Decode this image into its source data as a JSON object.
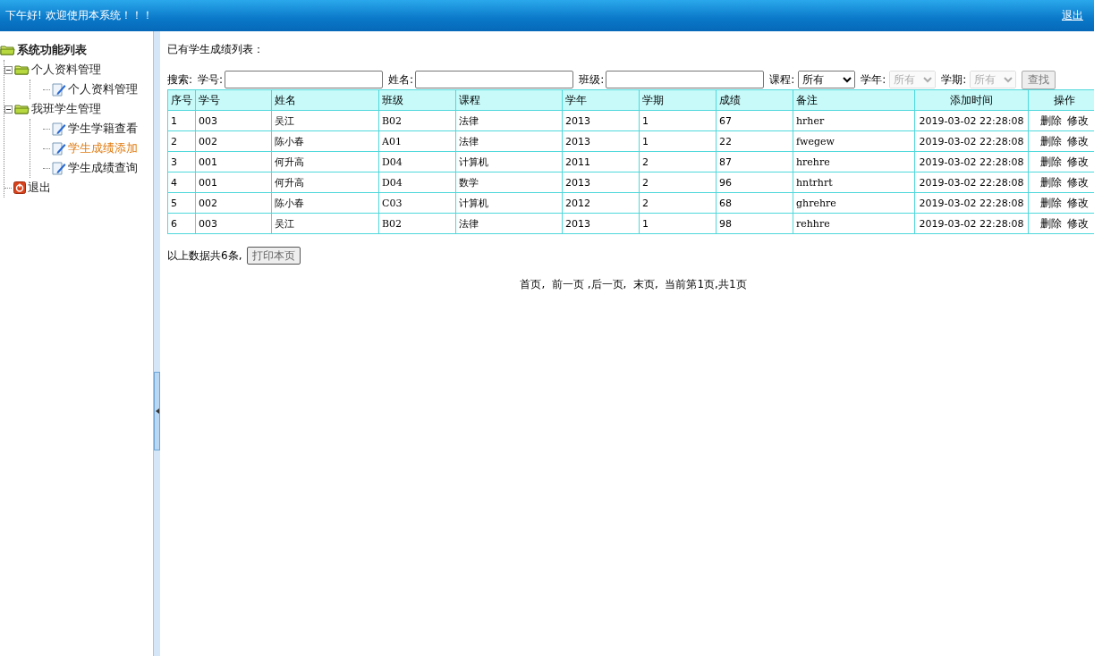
{
  "header": {
    "greeting": "下午好! 欢迎使用本系统！！！",
    "logout": "退出"
  },
  "sidebar": {
    "title": "系统功能列表",
    "items": [
      {
        "label": "个人资料管理",
        "kind": "folder",
        "expanded": true,
        "children": [
          {
            "label": "个人资料管理",
            "kind": "page",
            "selected": false
          }
        ]
      },
      {
        "label": "我班学生管理",
        "kind": "folder",
        "expanded": true,
        "children": [
          {
            "label": "学生学籍查看",
            "kind": "page",
            "selected": false
          },
          {
            "label": "学生成绩添加",
            "kind": "page",
            "selected": true
          },
          {
            "label": "学生成绩查询",
            "kind": "page",
            "selected": false
          }
        ]
      },
      {
        "label": "退出",
        "kind": "exit",
        "selected": false
      }
    ]
  },
  "page_title": "已有学生成绩列表：",
  "search": {
    "label": "搜索:",
    "fields": [
      {
        "kind": "text",
        "label": "学号:"
      },
      {
        "kind": "text",
        "label": "姓名:"
      },
      {
        "kind": "text",
        "label": "班级:"
      },
      {
        "kind": "select",
        "label": "课程:",
        "value": "所有",
        "disabled": false
      },
      {
        "kind": "select",
        "label": "学年:",
        "value": "所有",
        "disabled": true
      },
      {
        "kind": "select",
        "label": "学期:",
        "value": "所有",
        "disabled": true
      }
    ],
    "button": "查找"
  },
  "table": {
    "columns": [
      "序号",
      "学号",
      "姓名",
      "班级",
      "课程",
      "学年",
      "学期",
      "成绩",
      "备注",
      "添加时间",
      "操作"
    ],
    "rows": [
      {
        "cells": [
          "1",
          "003",
          "吴江",
          "B02",
          "法律",
          "2013",
          "1",
          "67",
          "hrher",
          "2019-03-02 22:28:08"
        ],
        "actions": [
          "删除",
          "修改"
        ]
      },
      {
        "cells": [
          "2",
          "002",
          "陈小春",
          "A01",
          "法律",
          "2013",
          "1",
          "22",
          "fwegew",
          "2019-03-02 22:28:08"
        ],
        "actions": [
          "删除",
          "修改"
        ]
      },
      {
        "cells": [
          "3",
          "001",
          "何升高",
          "D04",
          "计算机",
          "2011",
          "2",
          "87",
          "hrehre",
          "2019-03-02 22:28:08"
        ],
        "actions": [
          "删除",
          "修改"
        ]
      },
      {
        "cells": [
          "4",
          "001",
          "何升高",
          "D04",
          "数学",
          "2013",
          "2",
          "96",
          "hntrhrt",
          "2019-03-02 22:28:08"
        ],
        "actions": [
          "删除",
          "修改"
        ]
      },
      {
        "cells": [
          "5",
          "002",
          "陈小春",
          "C03",
          "计算机",
          "2012",
          "2",
          "68",
          "ghrehre",
          "2019-03-02 22:28:08"
        ],
        "actions": [
          "删除",
          "修改"
        ]
      },
      {
        "cells": [
          "6",
          "003",
          "吴江",
          "B02",
          "法律",
          "2013",
          "1",
          "98",
          "rehhre",
          "2019-03-02 22:28:08"
        ],
        "actions": [
          "删除",
          "修改"
        ]
      }
    ]
  },
  "summary": "以上数据共6条,",
  "print_button": "打印本页",
  "pagination": "首页,  前一页 ,后一页,  末页,  当前第1页,共1页"
}
